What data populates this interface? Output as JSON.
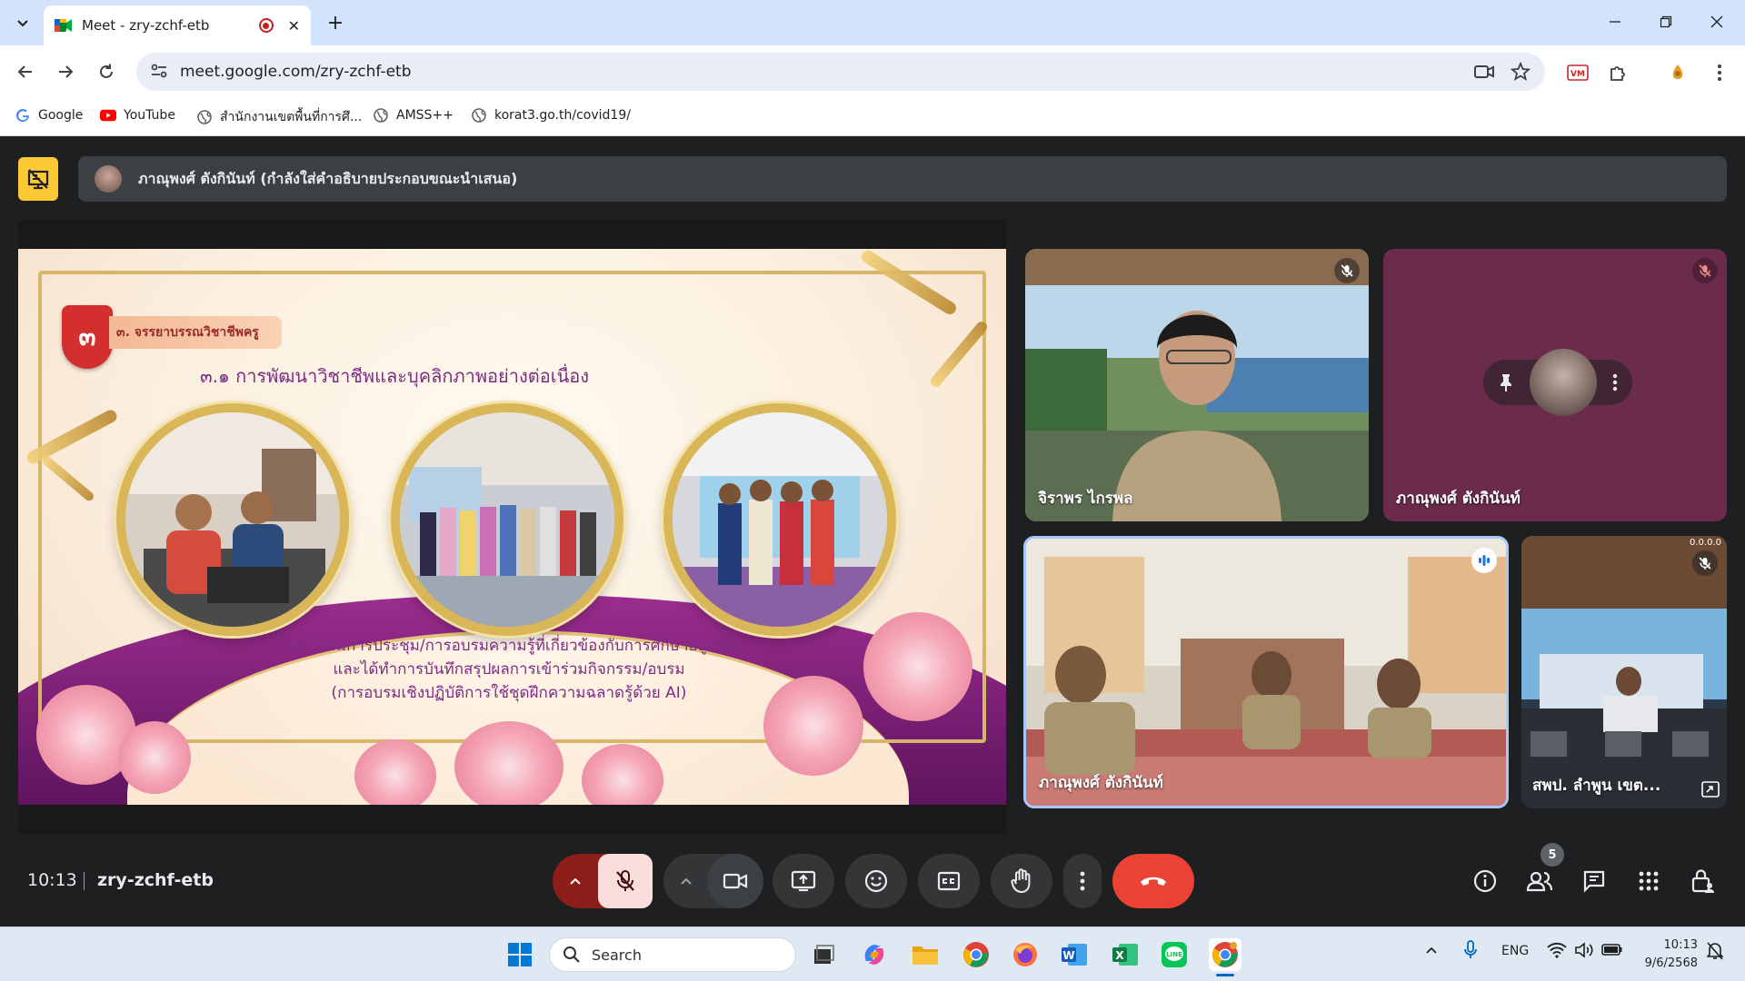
{
  "browser": {
    "tab_title": "Meet - zry-zchf-etb",
    "url": "meet.google.com/zry-zchf-etb",
    "new_tab_symbol": "+",
    "close_symbol": "✕"
  },
  "bookmarks": [
    {
      "label": "Google",
      "icon": "google-icon"
    },
    {
      "label": "YouTube",
      "icon": "youtube-icon"
    },
    {
      "label": "สำนักงานเขตพื้นที่การศึ...",
      "icon": "globe-icon"
    },
    {
      "label": "AMSS++",
      "icon": "globe-icon"
    },
    {
      "label": "korat3.go.th/covid19/",
      "icon": "globe-icon"
    }
  ],
  "meet": {
    "presenter_banner": "ภาณุพงศ์ ตังกินันท์ (กำลังใส่คำอธิบายประกอบขณะนำเสนอ)",
    "time": "10:13",
    "meeting_code": "zry-zchf-etb",
    "participants_count": "5",
    "colors": {
      "end_call": "#ea4335",
      "mic_off_bg": "#f9dedc",
      "presenting_badge": "#fcc934"
    }
  },
  "slide": {
    "badge_number": "๓",
    "section_label": "๓. จรรยาบรรณวิชาชีพครู",
    "subtitle": "๓.๑ การพัฒนาวิชาชีพและบุคลิกภาพอย่างต่อเนื่อง",
    "body_lines": [
      "ได้เข้าร่วมการประชุม/การอบรมความรู้ที่เกี่ยวข้องกับการศึกษาอยู่เสมอ",
      "และได้ทำการบันทึกสรุปผลการเข้าร่วมกิจกรรม/อบรม",
      "(การอบรมเชิงปฏิบัติการใช้ชุดฝึกความฉลาดรู้ด้วย AI)"
    ]
  },
  "tiles": [
    {
      "name": "จิราพร ไกรพล",
      "mic": "mic-off-icon"
    },
    {
      "name": "ภาณุพงศ์ ตังกินันท์",
      "mic": "mic-off-icon"
    },
    {
      "name": "ภาณุพงศ์ ตังกินันท์",
      "mic": "speaking-icon"
    },
    {
      "name": "สพป. ลำพูน เขต...",
      "mic": "mic-off-icon",
      "corner_text": "0.0.0.0"
    }
  ],
  "taskbar": {
    "search_placeholder": "Search",
    "language": "ENG",
    "clock_time": "10:13",
    "clock_date": "9/6/2568"
  }
}
